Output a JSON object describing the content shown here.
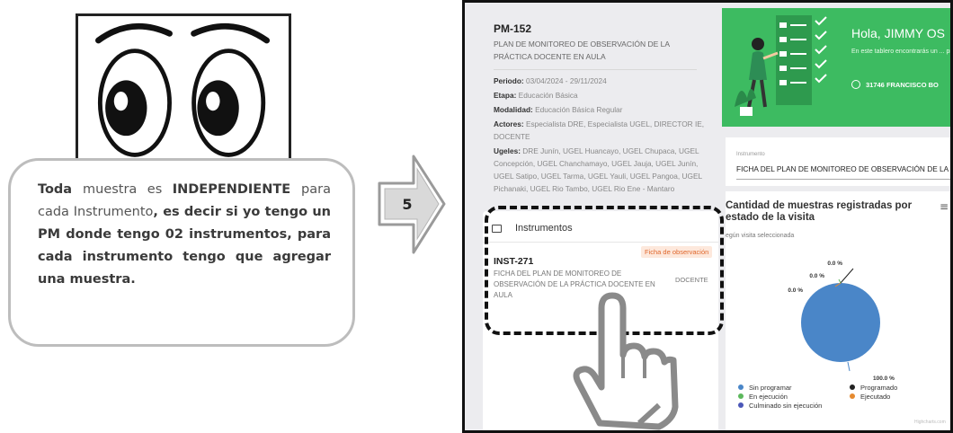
{
  "callout": {
    "text_parts": [
      {
        "t": "Toda ",
        "b": true
      },
      {
        "t": "muestra es ",
        "b": false
      },
      {
        "t": "INDEPENDIENTE ",
        "b": true
      },
      {
        "t": "para cada Instrumento",
        "b": false
      },
      {
        "t": ", es decir si yo tengo un PM donde tengo 02 instrumentos, para cada instrumento tengo que agregar una muestra.",
        "b": true
      }
    ]
  },
  "step": {
    "number": "5"
  },
  "plan": {
    "code": "PM-152",
    "title": "PLAN DE MONITOREO DE OBSERVACIÓN DE LA PRÁCTICA DOCENTE EN AULA",
    "fields": [
      {
        "label": "Periodo:",
        "value": " 03/04/2024 - 29/11/2024"
      },
      {
        "label": "Etapa:",
        "value": " Educación Básica"
      },
      {
        "label": "Modalidad:",
        "value": " Educación Básica Regular"
      },
      {
        "label": "Actores:",
        "value": " Especialista DRE, Especialista UGEL, DIRECTOR IE, DOCENTE"
      },
      {
        "label": "Ugeles:",
        "value": " DRE Junín, UGEL Huancayo, UGEL Chupaca, UGEL Concepción, UGEL Chanchamayo, UGEL Jauja, UGEL Junín, UGEL Satipo, UGEL Tarma, UGEL Yauli, UGEL Pangoa, UGEL Pichanaki, UGEL Rio Tambo, UGEL Rio Ene - Mantaro"
      }
    ]
  },
  "instruments": {
    "header": "Instrumentos",
    "items": [
      {
        "badge": "Ficha de observación",
        "code": "INST-271",
        "name": "FICHA DEL PLAN DE MONITOREO DE OBSERVACIÓN DE LA PRÁCTICA DOCENTE EN AULA",
        "role": "DOCENTE"
      }
    ]
  },
  "banner": {
    "greeting": "Hola, JIMMY OS",
    "subtitle": "En este tablero encontrarás un ... programación y ejecución de ta...",
    "user_badge": "31746 FRANCISCO BO"
  },
  "instrument_select": {
    "label": "Instrumento",
    "value": "FICHA DEL PLAN DE MONITOREO DE OBSERVACIÓN DE LA"
  },
  "chart_panel": {
    "title": "Cantidad de muestras registradas por estado de la visita",
    "subtitle": "egún visita seleccionada",
    "menu_icon": "hamburger-menu-icon",
    "credits": "Highcharts.com"
  },
  "chart_data": {
    "type": "pie",
    "title": "Cantidad de muestras registradas por estado de la visita",
    "slices": [
      {
        "name": "Sin programar",
        "value": 100.0,
        "label": "100.0 %",
        "color": "#4a86c8"
      },
      {
        "name": "Programado",
        "value": 0.0,
        "label": "0.0 %",
        "color": "#222222"
      },
      {
        "name": "En ejecución",
        "value": 0.0,
        "label": "0.0 %",
        "color": "#5cb85c"
      },
      {
        "name": "Ejecutado",
        "value": 0.0,
        "label": "0.0 %",
        "color": "#e58a2f"
      },
      {
        "name": "Culminado sin ejecución",
        "value": 0.0,
        "label": "",
        "color": "#4b57b8"
      }
    ],
    "legend_position": "bottom"
  }
}
